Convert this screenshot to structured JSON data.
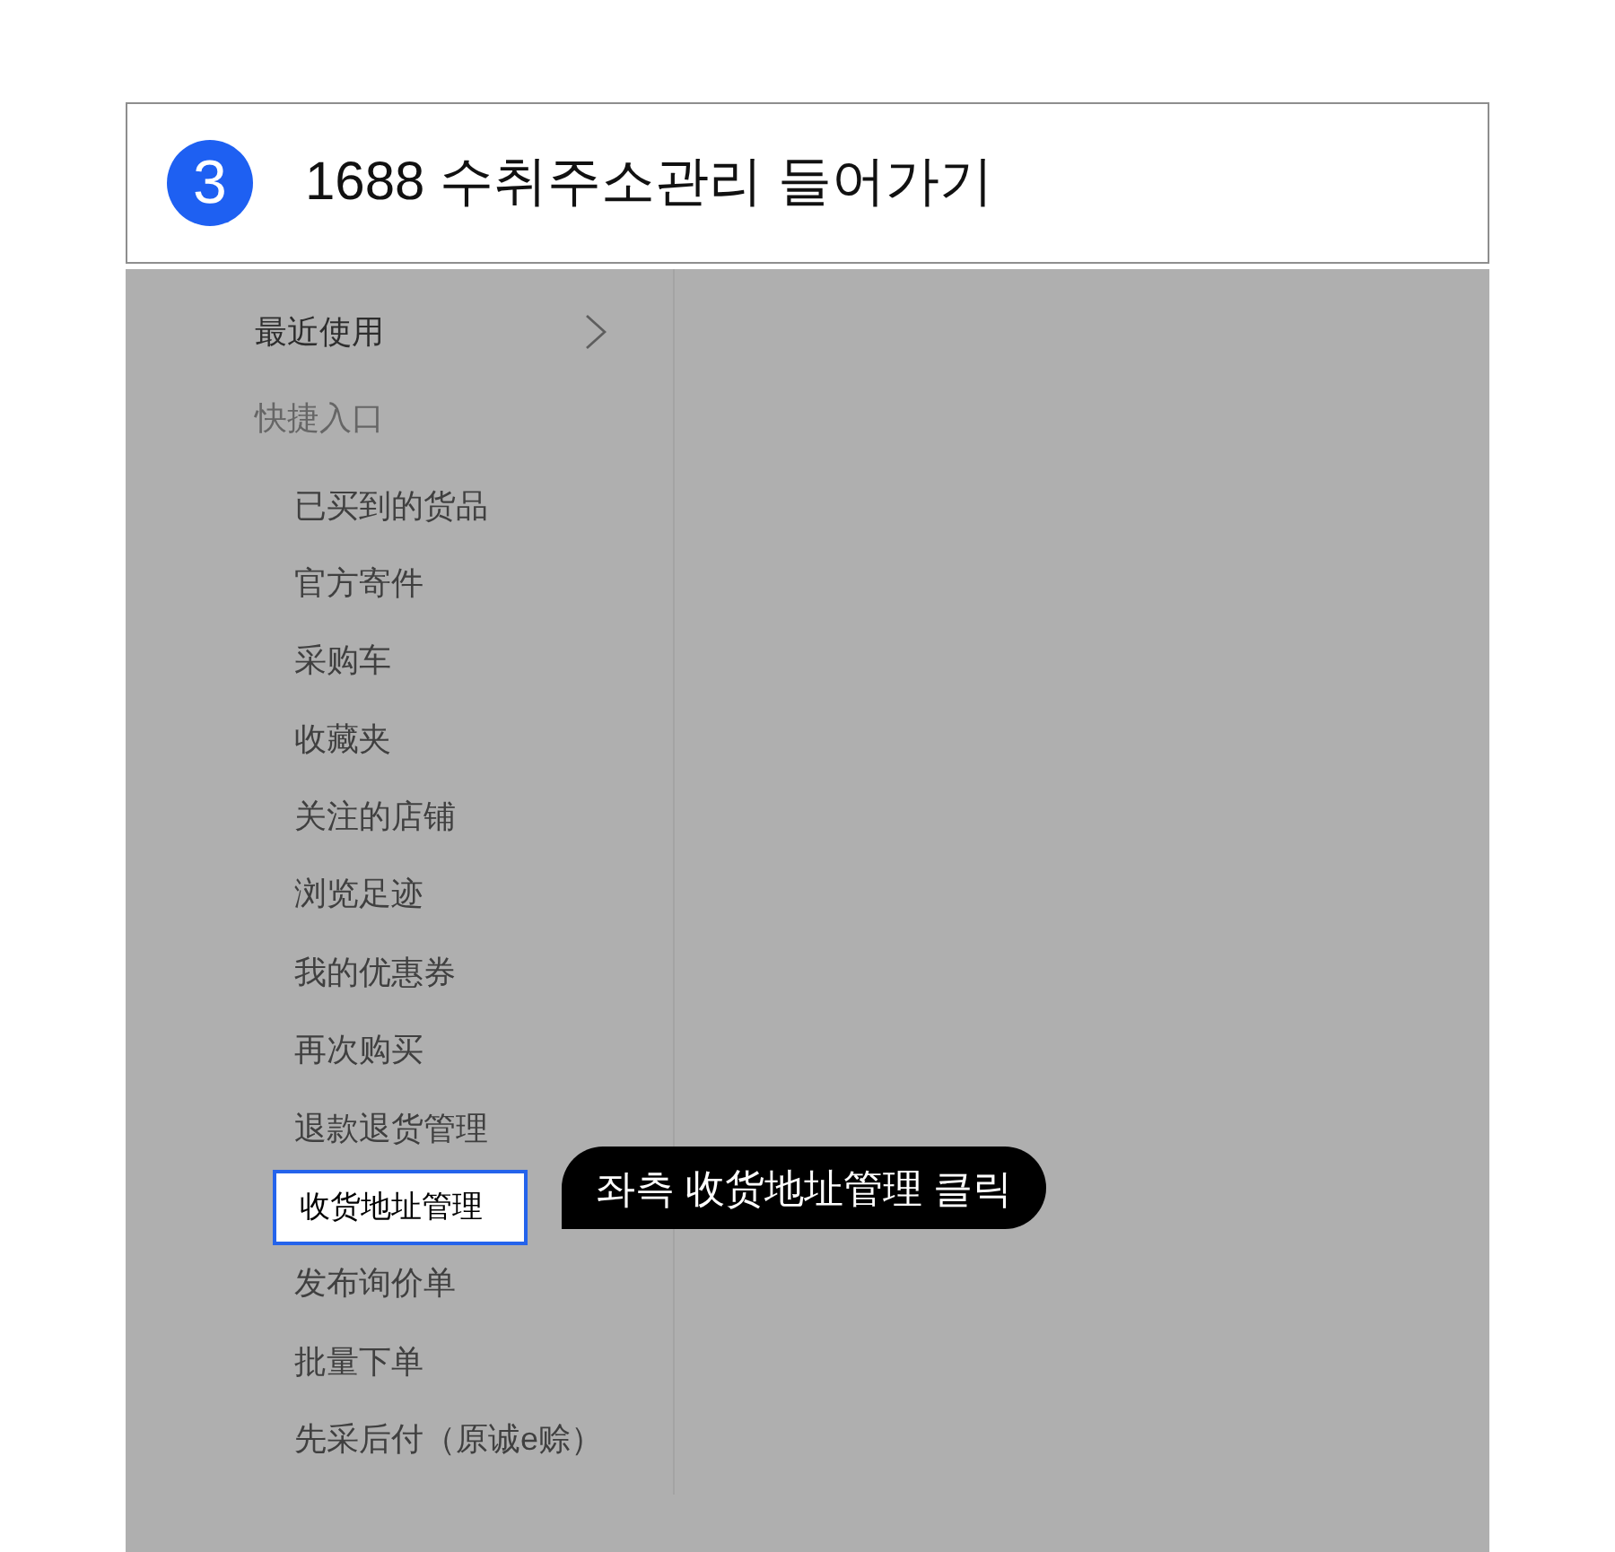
{
  "step": {
    "number": "3",
    "title": "1688 수취주소관리 들어가기"
  },
  "sidebar": {
    "recent": {
      "label": "最近使用"
    },
    "section_label": "快捷入口",
    "items": [
      {
        "label": "已买到的货品",
        "highlighted": false
      },
      {
        "label": "官方寄件",
        "highlighted": false
      },
      {
        "label": "采购车",
        "highlighted": false
      },
      {
        "label": "收藏夹",
        "highlighted": false
      },
      {
        "label": "关注的店铺",
        "highlighted": false
      },
      {
        "label": "浏览足迹",
        "highlighted": false
      },
      {
        "label": "我的优惠券",
        "highlighted": false
      },
      {
        "label": "再次购买",
        "highlighted": false
      },
      {
        "label": "退款退货管理",
        "highlighted": false
      },
      {
        "label": "收货地址管理",
        "highlighted": true
      },
      {
        "label": "发布询价单",
        "highlighted": false
      },
      {
        "label": "批量下单",
        "highlighted": false
      },
      {
        "label": "先采后付（原诚e赊）",
        "highlighted": false
      }
    ]
  },
  "callout": {
    "text": "좌측 收货地址管理 클릭"
  }
}
